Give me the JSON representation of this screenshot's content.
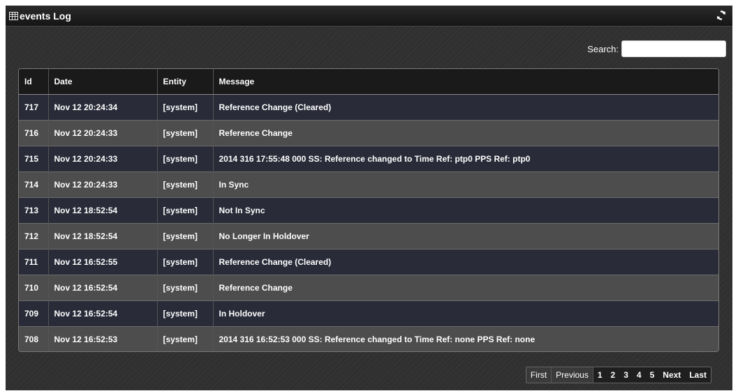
{
  "header": {
    "title": "events Log",
    "icon": "grid-icon",
    "refresh_icon": "refresh-icon"
  },
  "search": {
    "label": "Search:",
    "value": "",
    "placeholder": ""
  },
  "table": {
    "columns": [
      "Id",
      "Date",
      "Entity",
      "Message"
    ],
    "rows": [
      {
        "id": "717",
        "date": "Nov 12 20:24:34",
        "entity": "[system]",
        "message": "Reference Change (Cleared)"
      },
      {
        "id": "716",
        "date": "Nov 12 20:24:33",
        "entity": "[system]",
        "message": "Reference Change"
      },
      {
        "id": "715",
        "date": "Nov 12 20:24:33",
        "entity": "[system]",
        "message": "2014 316 17:55:48 000 SS: Reference changed to Time Ref: ptp0 PPS Ref: ptp0"
      },
      {
        "id": "714",
        "date": "Nov 12 20:24:33",
        "entity": "[system]",
        "message": "In Sync"
      },
      {
        "id": "713",
        "date": "Nov 12 18:52:54",
        "entity": "[system]",
        "message": "Not In Sync"
      },
      {
        "id": "712",
        "date": "Nov 12 18:52:54",
        "entity": "[system]",
        "message": "No Longer In Holdover"
      },
      {
        "id": "711",
        "date": "Nov 12 16:52:55",
        "entity": "[system]",
        "message": "Reference Change (Cleared)"
      },
      {
        "id": "710",
        "date": "Nov 12 16:52:54",
        "entity": "[system]",
        "message": "Reference Change"
      },
      {
        "id": "709",
        "date": "Nov 12 16:52:54",
        "entity": "[system]",
        "message": "In Holdover"
      },
      {
        "id": "708",
        "date": "Nov 12 16:52:53",
        "entity": "[system]",
        "message": "2014 316 16:52:53 000 SS: Reference changed to Time Ref: none PPS Ref: none"
      }
    ]
  },
  "pagination": {
    "first": "First",
    "previous": "Previous",
    "pages": [
      "1",
      "2",
      "3",
      "4",
      "5"
    ],
    "next": "Next",
    "last": "Last"
  },
  "colors": {
    "panel_bg": "#2f2f2f",
    "row_odd": "#292b38",
    "row_even": "#4d4d4d",
    "header_bg": "#1a1a1a",
    "text": "#ffffff"
  }
}
